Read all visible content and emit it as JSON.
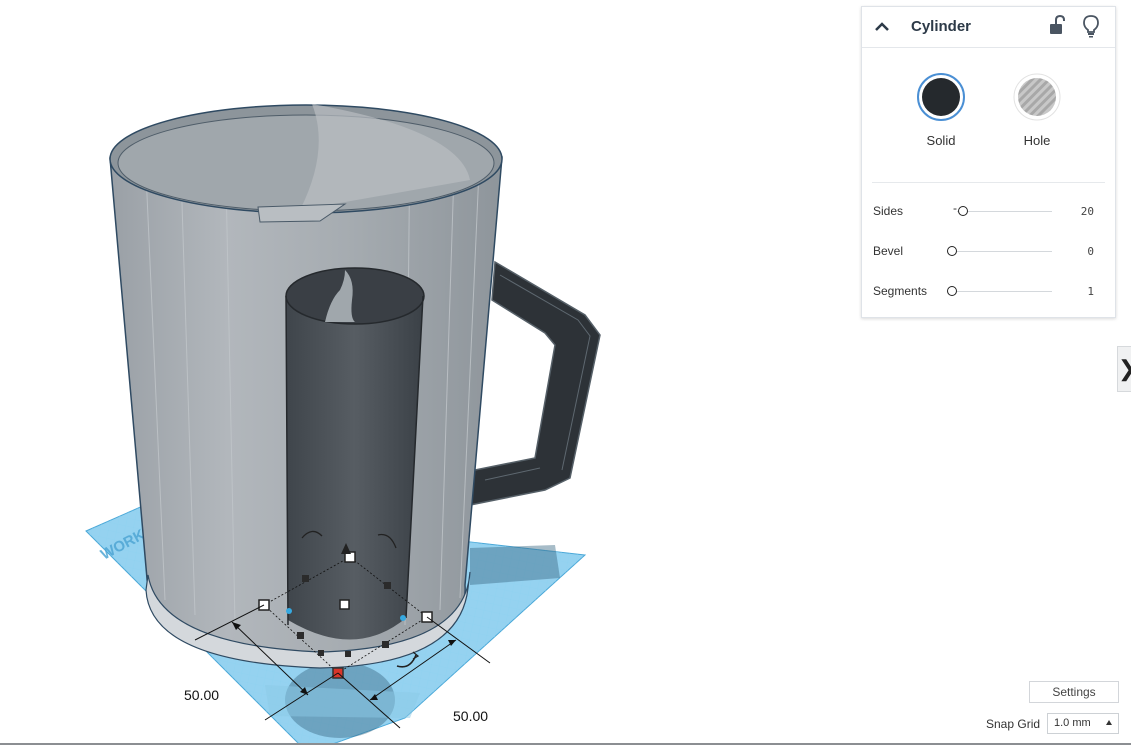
{
  "inspector": {
    "title": "Cylinder",
    "icons": {
      "collapse": "chevron-up-icon",
      "lock": "unlock-icon",
      "bulb": "lightbulb-icon"
    },
    "modes": [
      {
        "label": "Solid",
        "selected": true,
        "color": "#25292d"
      },
      {
        "label": "Hole",
        "selected": false,
        "color": "#b4b4b4"
      }
    ],
    "properties": [
      {
        "label": "Sides",
        "value": "20",
        "level": 0.1
      },
      {
        "label": "Bevel",
        "value": "0",
        "level": 0
      },
      {
        "label": "Segments",
        "value": "1",
        "level": 0
      }
    ]
  },
  "viewport": {
    "dimension_width": "50.00",
    "dimension_depth": "50.00",
    "workplane_text": "WORKPLANE",
    "colors": {
      "workplane": "#5cb8e6",
      "mug": "#a3a9ae",
      "handle": "#2e3338",
      "selected_cylinder": "#4a5056",
      "selection_handle": "#d9362b"
    }
  },
  "side_tab": {
    "icon": "chevron-right-icon",
    "glyph": "❯"
  },
  "footer": {
    "settings_label": "Settings",
    "snap_grid_label": "Snap Grid",
    "snap_grid_value": "1.0 mm"
  }
}
